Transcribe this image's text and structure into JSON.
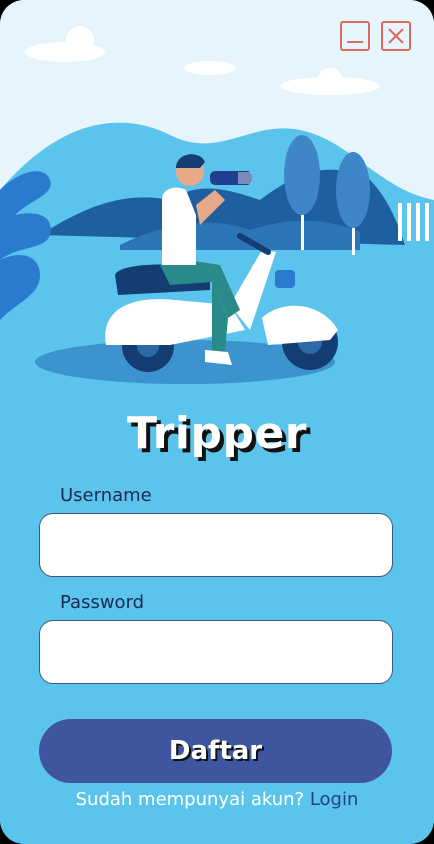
{
  "app": {
    "title": "Tripper"
  },
  "window_controls": {
    "minimize_icon": "minimize-icon",
    "close_icon": "close-icon"
  },
  "form": {
    "username_label": "Username",
    "username_value": "",
    "password_label": "Password",
    "password_value": "",
    "submit_label": "Daftar"
  },
  "footer": {
    "prompt": "Sudah mempunyai akun?",
    "login_link": "Login"
  },
  "colors": {
    "accent": "#3e56a0",
    "background": "#5bc4ec",
    "sky": "#e6f5fc",
    "window_control": "#e0685d"
  }
}
